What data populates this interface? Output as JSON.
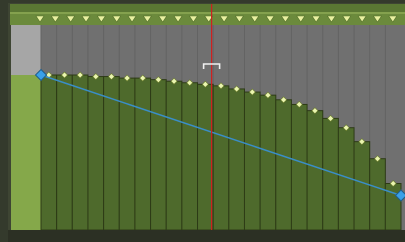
{
  "app": {
    "kind": "automation-lane-editor"
  },
  "colors": {
    "frame": "#343a2c",
    "header": "#6b8a3c",
    "header_dark": "#4b6229",
    "header_line": "#9db860",
    "left_strip_top": "#a6a6a6",
    "left_strip_bottom": "#85a84a",
    "track_top": "#707070",
    "track_top_stripe": "#636363",
    "bar_fill": "#4e6a2c",
    "bar_stroke": "#2d3b16",
    "grid_line": "#3a4a20",
    "lane_line": "#3a8ec8",
    "node_fill": "#3aa0e8",
    "node_stroke": "#1e5e8c",
    "point_fill": "#eaf5b0",
    "point_stroke": "#6b7d2a",
    "triangle": "#e8f0a0",
    "playhead": "#d02020",
    "bracket": "#f0f0f0"
  },
  "automation": {
    "num_columns": 23,
    "bar_levels": [
      1.0,
      1.0,
      1.0,
      0.99,
      0.99,
      0.98,
      0.98,
      0.97,
      0.96,
      0.95,
      0.94,
      0.93,
      0.91,
      0.89,
      0.87,
      0.84,
      0.81,
      0.77,
      0.72,
      0.66,
      0.57,
      0.46,
      0.3
    ],
    "envelope_start": 1.0,
    "envelope_end": 0.3,
    "playhead_column": 10.9
  }
}
